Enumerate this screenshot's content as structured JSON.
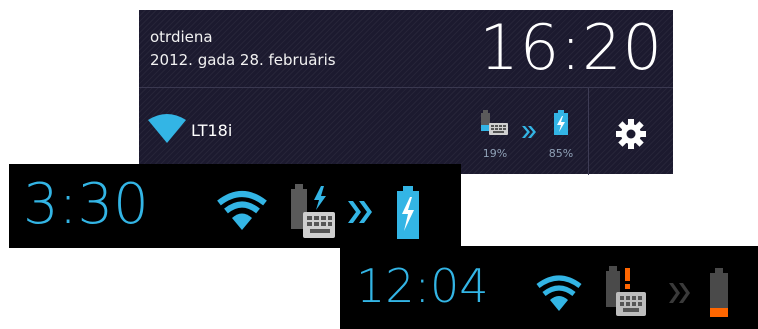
{
  "notification_panel": {
    "day": "otrdiena",
    "date": "2012. gada 28. februāris",
    "time": "16:20",
    "ssid": "LT18i",
    "dock_battery_percent": "19%",
    "tablet_battery_percent": "85%",
    "settings_icon": "gear-icon"
  },
  "status_bar_1": {
    "time": "3:30",
    "icons": [
      "wifi-icon",
      "dock-battery-charging-icon",
      "chevron-right-icon",
      "battery-charging-icon"
    ]
  },
  "status_bar_2": {
    "time": "12:04",
    "icons": [
      "wifi-icon",
      "dock-battery-alert-icon",
      "chevron-right-icon",
      "battery-low-icon"
    ]
  },
  "colors": {
    "accent": "#33b5e5",
    "alert": "#ff6600",
    "panel_bg": "#1c1a2f"
  }
}
